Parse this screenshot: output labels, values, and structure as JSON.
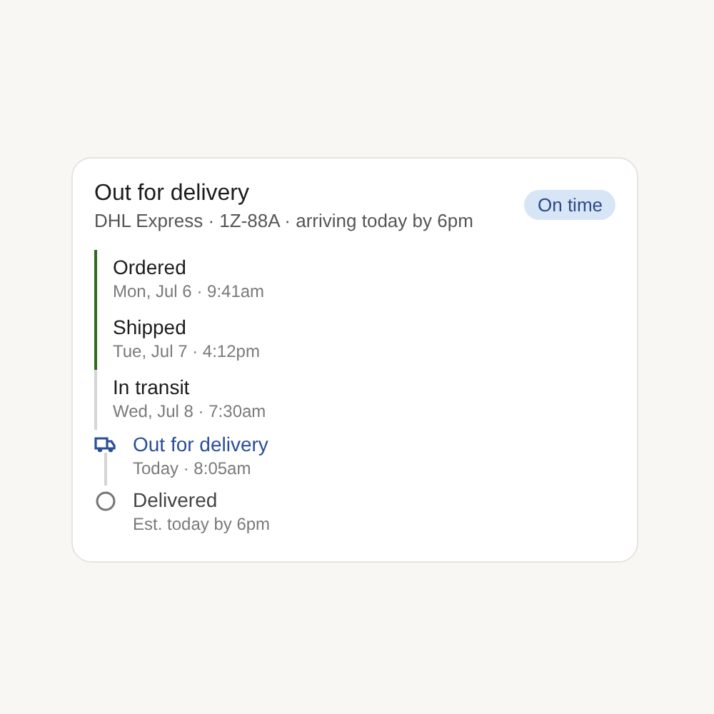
{
  "shipment": {
    "title": "Out for delivery",
    "subtitle": "DHL Express · 1Z-88A · arriving today by 6pm",
    "badge": "On time"
  },
  "steps": [
    {
      "kind": "done",
      "label": "Ordered",
      "time": "Mon, Jul 6 · 9:41am"
    },
    {
      "kind": "done",
      "label": "Shipped",
      "time": "Tue, Jul 7 · 4:12pm"
    },
    {
      "kind": "latest",
      "label": "In transit",
      "time": "Wed, Jul 8 · 7:30am"
    },
    {
      "kind": "current",
      "label": "Out for delivery",
      "time": "Today · 8:05am"
    },
    {
      "kind": "pending",
      "label": "Delivered",
      "time": "Est. today by 6pm"
    }
  ]
}
